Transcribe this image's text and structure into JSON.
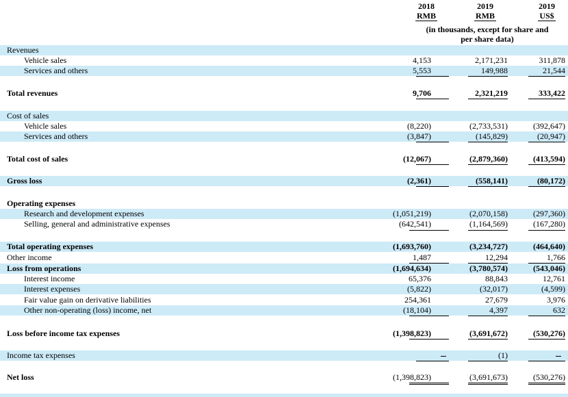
{
  "header": {
    "col1": {
      "year": "2018",
      "currency": "RMB"
    },
    "col2": {
      "year": "2019",
      "currency": "RMB"
    },
    "col3": {
      "year": "2019",
      "currency": "US$"
    },
    "note_line1": "(in thousands, except for share and",
    "note_line2": "per share data)"
  },
  "rows": [
    {
      "label": "Revenues",
      "v": [
        "",
        "",
        ""
      ]
    },
    {
      "label": "Vehicle sales",
      "v": [
        "4,153",
        "2,171,231",
        "311,878"
      ]
    },
    {
      "label": "Services and others",
      "v": [
        "5,553",
        "149,988",
        "21,544"
      ]
    },
    {
      "label": "Total revenues",
      "v": [
        "9,706",
        "2,321,219",
        "333,422"
      ]
    },
    {
      "label": "Cost of sales",
      "v": [
        "",
        "",
        ""
      ]
    },
    {
      "label": "Vehicle sales",
      "v": [
        "(8,220)",
        "(2,733,531)",
        "(392,647)"
      ]
    },
    {
      "label": "Services and others",
      "v": [
        "(3,847)",
        "(145,829)",
        "(20,947)"
      ]
    },
    {
      "label": "Total cost of sales",
      "v": [
        "(12,067)",
        "(2,879,360)",
        "(413,594)"
      ]
    },
    {
      "label": "Gross loss",
      "v": [
        "(2,361)",
        "(558,141)",
        "(80,172)"
      ]
    },
    {
      "label": "Operating expenses",
      "v": [
        "",
        "",
        ""
      ]
    },
    {
      "label": "Research and development expenses",
      "v": [
        "(1,051,219)",
        "(2,070,158)",
        "(297,360)"
      ]
    },
    {
      "label": "Selling, general and administrative expenses",
      "v": [
        "(642,541)",
        "(1,164,569)",
        "(167,280)"
      ]
    },
    {
      "label": "Total operating expenses",
      "v": [
        "(1,693,760)",
        "(3,234,727)",
        "(464,640)"
      ]
    },
    {
      "label": "Other income",
      "v": [
        "1,487",
        "12,294",
        "1,766"
      ]
    },
    {
      "label": "Loss from operations",
      "v": [
        "(1,694,634)",
        "(3,780,574)",
        "(543,046)"
      ]
    },
    {
      "label": "Interest income",
      "v": [
        "65,376",
        "88,843",
        "12,761"
      ]
    },
    {
      "label": "Interest expenses",
      "v": [
        "(5,822)",
        "(32,017)",
        "(4,599)"
      ]
    },
    {
      "label": "Fair value gain on derivative liabilities",
      "v": [
        "254,361",
        "27,679",
        "3,976"
      ]
    },
    {
      "label": "Other non-operating (loss) income, net",
      "v": [
        "(18,104)",
        "4,397",
        "632"
      ]
    },
    {
      "label": "Loss before income tax expenses",
      "v": [
        "(1,398,823)",
        "(3,691,672)",
        "(530,276)"
      ]
    },
    {
      "label": "Income tax expenses",
      "v": [
        "",
        "(1)",
        ""
      ]
    },
    {
      "label": "Net loss",
      "v": [
        "(1,398,823)",
        "(3,691,673)",
        "(530,276)"
      ]
    }
  ]
}
